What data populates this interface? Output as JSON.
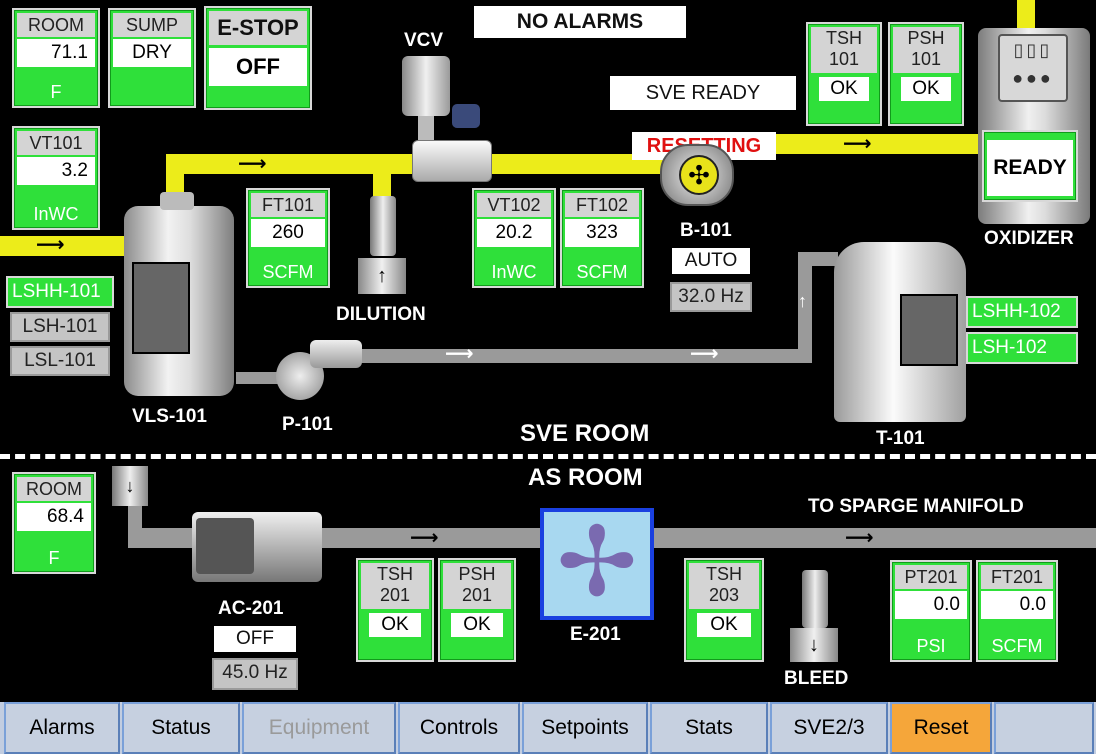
{
  "header": {
    "alarm_status": "NO ALARMS",
    "sve_status": "SVE READY",
    "resetting": "RESETTING"
  },
  "room": {
    "title": "ROOM",
    "value": "71.1",
    "unit": "F"
  },
  "sump": {
    "title": "SUMP",
    "value": "DRY"
  },
  "estop": {
    "title": "E-STOP",
    "value": "OFF"
  },
  "vt101": {
    "title": "VT101",
    "value": "3.2",
    "unit": "InWC"
  },
  "ft101": {
    "title": "FT101",
    "value": "260",
    "unit": "SCFM"
  },
  "vt102": {
    "title": "VT102",
    "value": "20.2",
    "unit": "InWC"
  },
  "ft102": {
    "title": "FT102",
    "value": "323",
    "unit": "SCFM"
  },
  "tsh101": {
    "title": "TSH\n101",
    "value": "OK"
  },
  "psh101": {
    "title": "PSH\n101",
    "value": "OK"
  },
  "oxidizer": {
    "state": "READY",
    "label": "OXIDIZER"
  },
  "labels": {
    "vcv": "VCV",
    "dilution": "DILUTION",
    "vls101": "VLS-101",
    "p101": "P-101",
    "b101": "B-101",
    "t101": "T-101",
    "sve_room": "SVE ROOM",
    "as_room": "AS ROOM",
    "ac201": "AC-201",
    "e201": "E-201",
    "bleed": "BLEED",
    "to_sparge": "TO SPARGE MANIFOLD"
  },
  "b101": {
    "mode": "AUTO",
    "freq": "32.0 Hz"
  },
  "levels_left": {
    "lshh": "LSHH-101",
    "lsh": "LSH-101",
    "lsl": "LSL-101"
  },
  "levels_right": {
    "lshh": "LSHH-102",
    "lsh": "LSH-102"
  },
  "room2": {
    "title": "ROOM",
    "value": "68.4",
    "unit": "F"
  },
  "ac201": {
    "state": "OFF",
    "freq": "45.0 Hz"
  },
  "tsh201": {
    "title": "TSH\n201",
    "value": "OK"
  },
  "psh201": {
    "title": "PSH\n201",
    "value": "OK"
  },
  "tsh203": {
    "title": "TSH\n203",
    "value": "OK"
  },
  "pt201": {
    "title": "PT201",
    "value": "0.0",
    "unit": "PSI"
  },
  "ft201": {
    "title": "FT201",
    "value": "0.0",
    "unit": "SCFM"
  },
  "nav": [
    "Alarms",
    "Status",
    "Equipment",
    "Controls",
    "Setpoints",
    "Stats",
    "SVE2/3",
    "Reset",
    ""
  ],
  "colors": {
    "ok_green": "#2fe03a",
    "pipe_yellow": "#ecec1a",
    "reset_orange": "#f5a63a",
    "alert_red": "#e01010"
  }
}
